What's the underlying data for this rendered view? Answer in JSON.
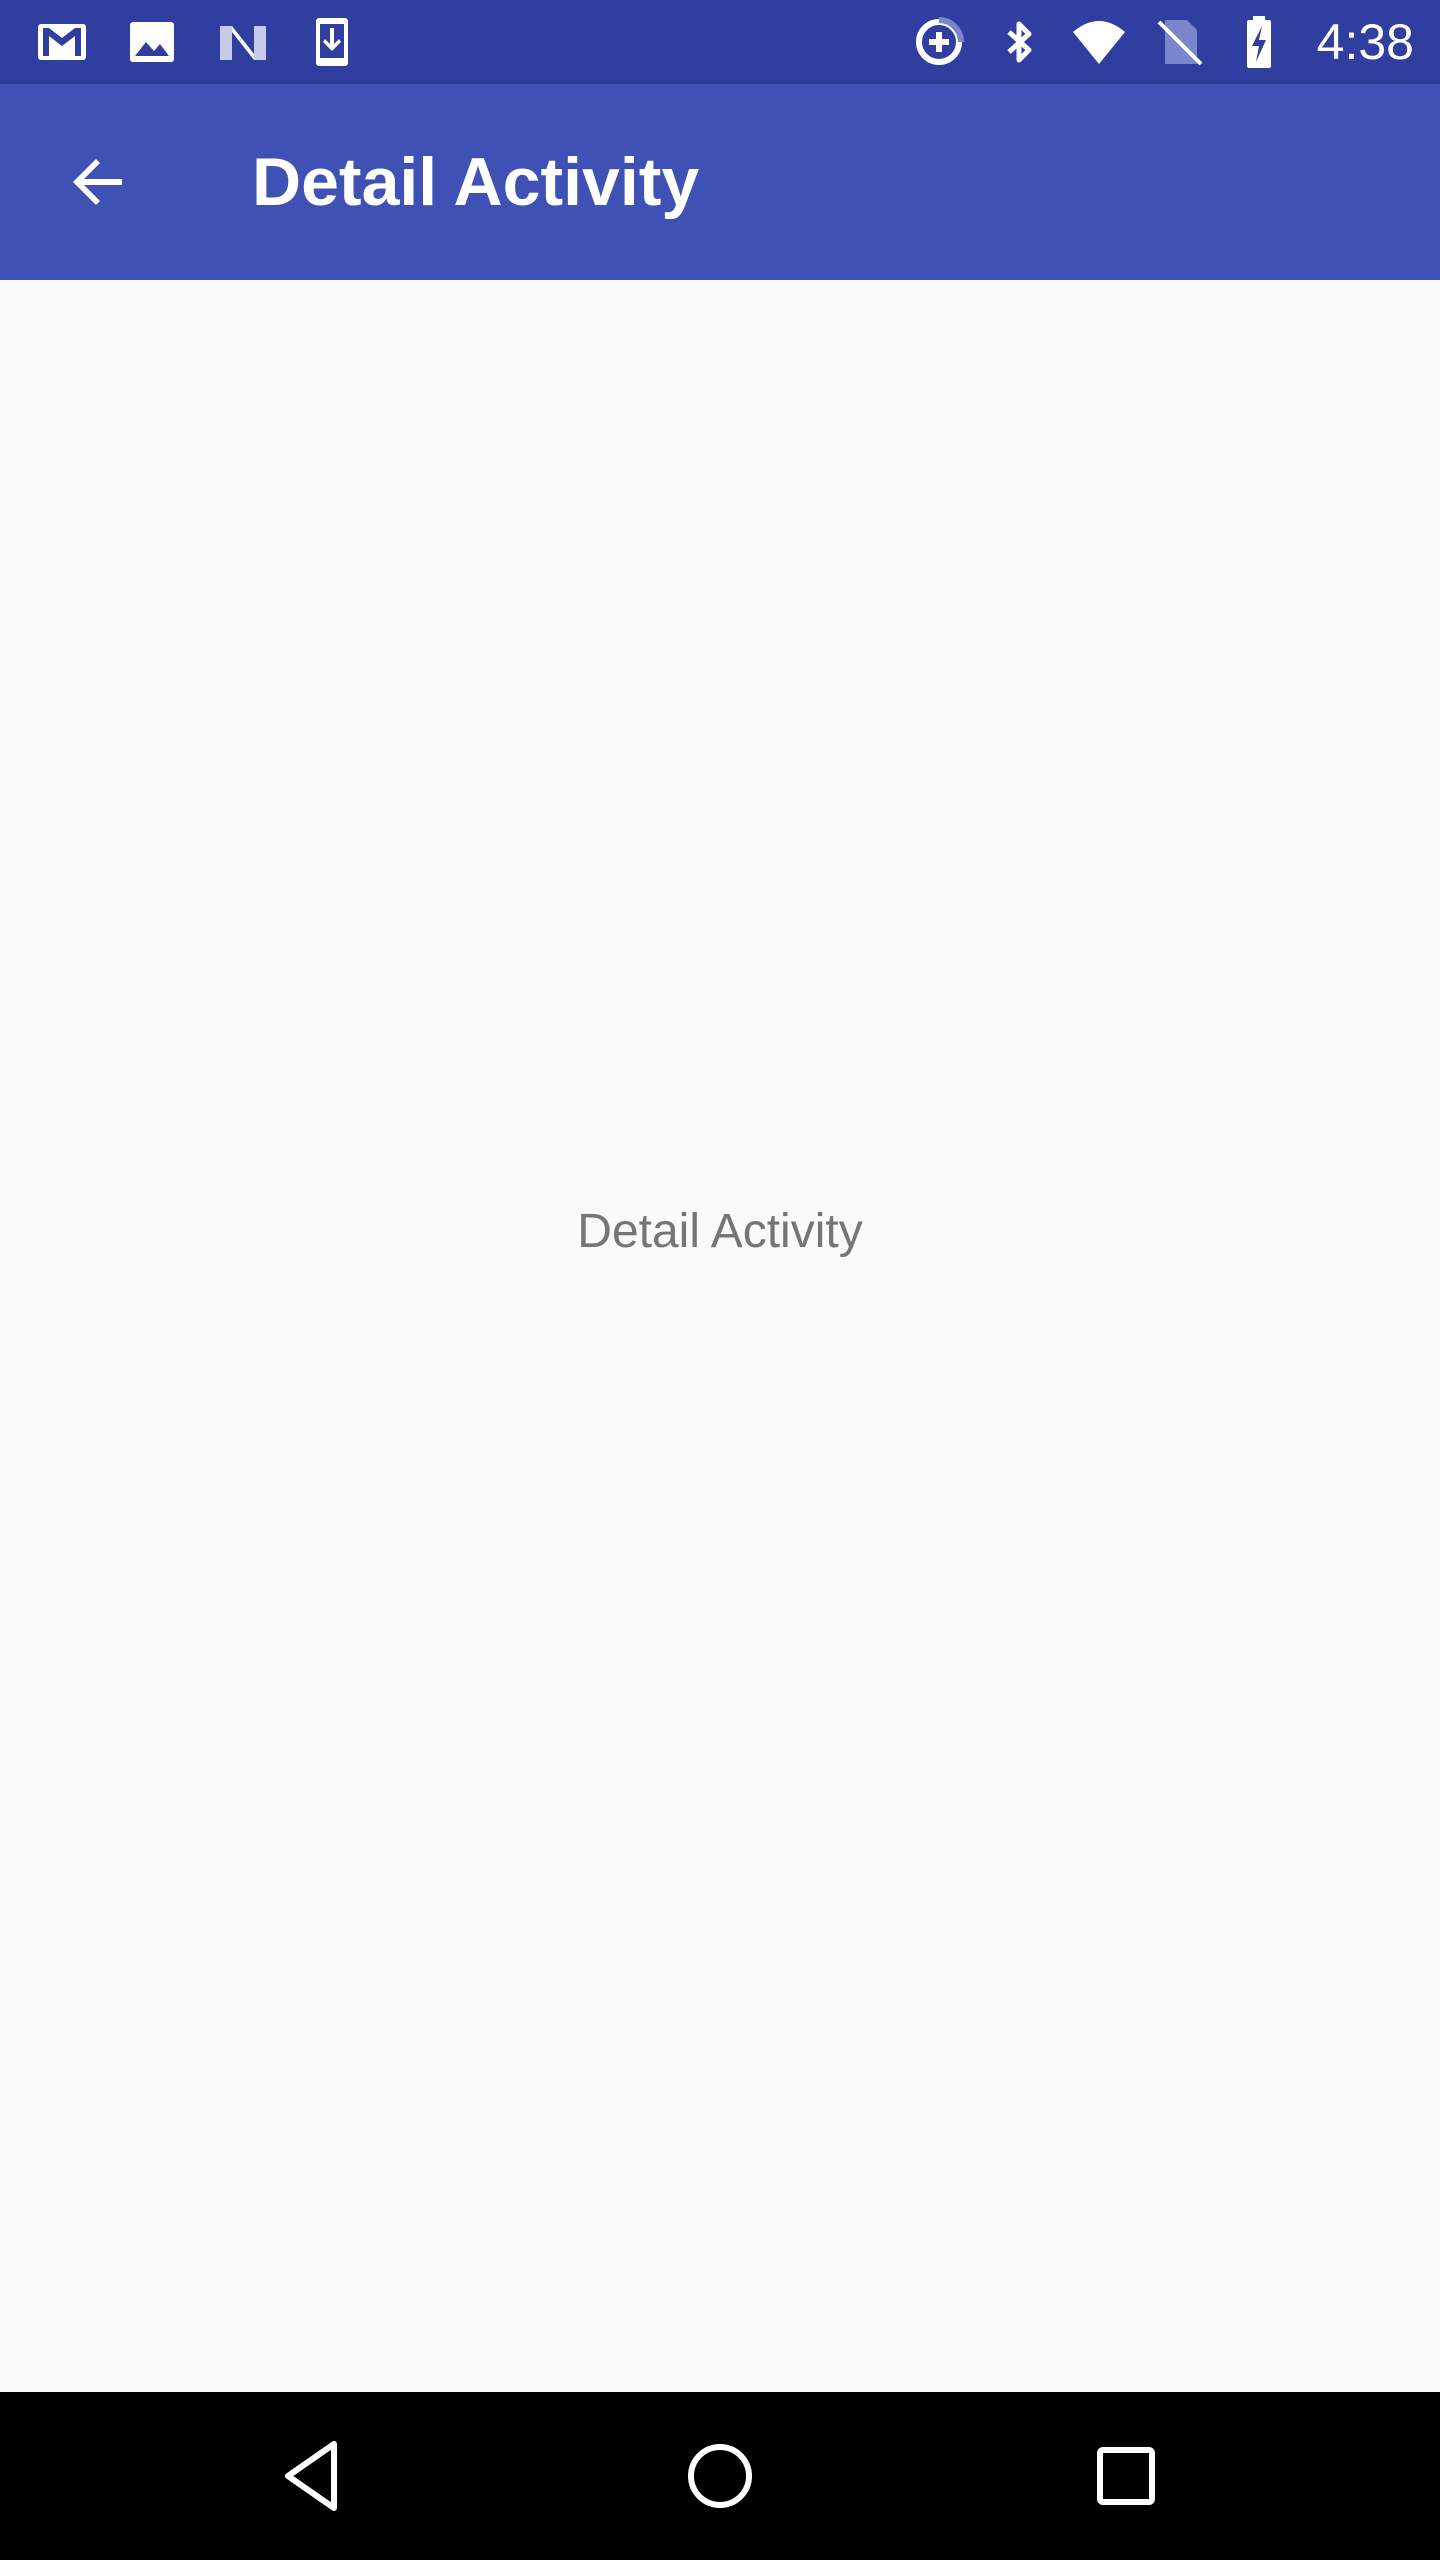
{
  "status_bar": {
    "time": "4:38",
    "background_color": "#303f9f",
    "left_icons": [
      "gmail-icon",
      "gallery-icon",
      "n-logo-icon",
      "download-icon"
    ],
    "right_icons": [
      "data-saver-icon",
      "bluetooth-icon",
      "wifi-icon",
      "no-sim-icon",
      "battery-charging-icon"
    ]
  },
  "toolbar": {
    "title": "Detail Activity",
    "background_color": "#3f51b5",
    "back_icon": "arrow-back-icon"
  },
  "content": {
    "center_text": "Detail Activity",
    "background_color": "#fafafa"
  },
  "nav_bar": {
    "buttons": [
      "nav-back-icon",
      "nav-home-icon",
      "nav-recents-icon"
    ],
    "background_color": "#000000"
  }
}
